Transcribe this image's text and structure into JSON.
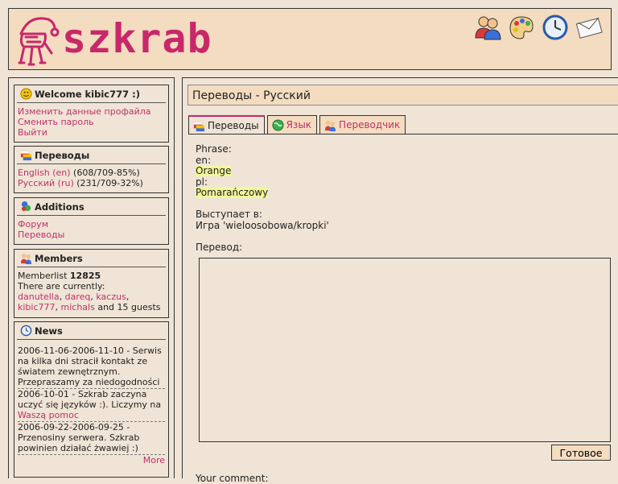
{
  "header": {
    "logo_text": "szkrab",
    "icons": [
      "users-icon",
      "palette-icon",
      "clock-icon",
      "mail-icon"
    ]
  },
  "sidebar": {
    "welcome": {
      "title": "Welcome kibic777 :)",
      "links": [
        "Изменить данные профайла",
        "Сменить пароль",
        "Выйти"
      ]
    },
    "translations": {
      "title": "Переводы",
      "items": [
        {
          "lang": "English (en)",
          "stats": "(608/709-85%)"
        },
        {
          "lang": "Русский (ru)",
          "stats": "(231/709-32%)"
        }
      ]
    },
    "additions": {
      "title": "Additions",
      "links": [
        "Форум",
        "Переводы"
      ]
    },
    "members": {
      "title": "Members",
      "memberlist_label": "Memberlist",
      "memberlist_count": "12825",
      "currently": "There are currently:",
      "users": [
        "danutella",
        "dareq",
        "kaczus",
        "kibic777",
        "michals"
      ],
      "guests": "and 15 guests"
    },
    "news": {
      "title": "News",
      "items": [
        {
          "text": "2006-11-06-2006-11-10 - Serwis na kilka dni stracił kontakt ze światem zewnętrznym. Przepraszamy za niedogodności"
        },
        {
          "text": "2006-10-01 - Szkrab zaczyna uczyć się języków :). Liczymy na ",
          "link": "Waszą pomoc"
        },
        {
          "text": "2006-09-22-2006-09-25 - Przenosiny serwera. Szkrab powinien działać żwawiej :)"
        }
      ],
      "more": "More"
    }
  },
  "main": {
    "title": "Переводы - Русский",
    "tabs": [
      {
        "label": "Переводы",
        "active": true
      },
      {
        "label": "Язык",
        "active": false
      },
      {
        "label": "Переводчик",
        "active": false
      }
    ],
    "phrase_label": "Phrase:",
    "src_lang": "en:",
    "src_text": "Orange",
    "dst_lang": "pl:",
    "dst_text": "Pomarańczowy",
    "appears_label": "Выступает в:",
    "appears_value": "Игра 'wieloosobowa/kropki'",
    "translation_label": "Перевод:",
    "translation_value": "",
    "submit_label": "Готовое",
    "comment_label": "Your comment:"
  },
  "colors": {
    "accent": "#c8286a",
    "header_bg": "#f4dcc1",
    "page_bg": "#efe4d6",
    "highlight": "#f2f79a"
  }
}
